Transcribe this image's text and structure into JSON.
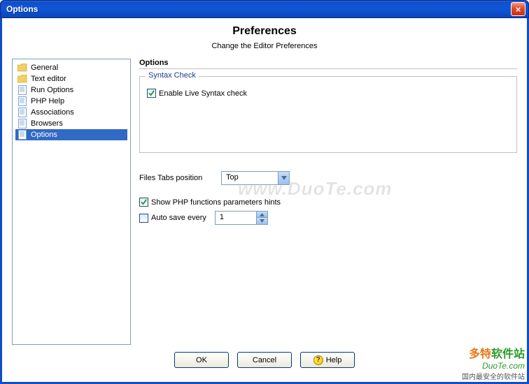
{
  "window": {
    "title": "Options",
    "close_symbol": "×"
  },
  "header": {
    "title": "Preferences",
    "subtitle": "Change the Editor Preferences"
  },
  "sidebar": {
    "items": [
      {
        "label": "General",
        "icon": "folder",
        "selected": false
      },
      {
        "label": "Text editor",
        "icon": "folder",
        "selected": false
      },
      {
        "label": "Run Options",
        "icon": "page",
        "selected": false
      },
      {
        "label": "PHP Help",
        "icon": "page",
        "selected": false
      },
      {
        "label": "Associations",
        "icon": "page",
        "selected": false
      },
      {
        "label": "Browsers",
        "icon": "page",
        "selected": false
      },
      {
        "label": "Options",
        "icon": "page",
        "selected": true
      }
    ]
  },
  "content": {
    "section_title": "Options",
    "syntax_group_title": "Syntax Check",
    "enable_live_syntax_label": "Enable Live Syntax check",
    "enable_live_syntax_checked": true,
    "files_tabs_label": "Files Tabs position",
    "files_tabs_value": "Top",
    "show_php_hints_label": "Show PHP functions parameters hints",
    "show_php_hints_checked": true,
    "auto_save_label": "Auto save every",
    "auto_save_checked": false,
    "auto_save_value": "1"
  },
  "buttons": {
    "ok": "OK",
    "cancel": "Cancel",
    "help": "Help"
  },
  "watermark": "www.DuoTe.com",
  "brand": {
    "line1a": "多特",
    "line1b": "软件站",
    "line2": "DuoTe.com",
    "line3": "国内最安全的软件站"
  }
}
